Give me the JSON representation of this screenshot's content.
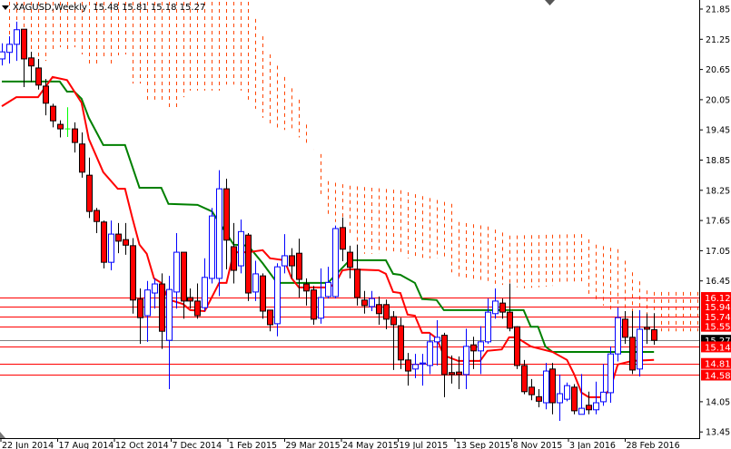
{
  "header": {
    "symbol": "XAGUSD,Weekly",
    "ohlc": "15.48 15.81 15.18 15.27"
  },
  "colors": {
    "bull": "#0000ff",
    "bear": "#ff0000",
    "doji": "#00ff00",
    "tenkan": "#ff0000",
    "kijun": "#008000",
    "cloud": "#ff4500",
    "level": "#ff0000",
    "current": "#808080"
  },
  "chart_data": {
    "type": "candlestick",
    "title": "XAGUSD,Weekly",
    "ylim": [
      13.45,
      22.0
    ],
    "y_ticks": [
      "21.85",
      "21.25",
      "20.65",
      "20.05",
      "19.45",
      "18.85",
      "18.25",
      "17.65",
      "17.05",
      "16.45",
      "14.05",
      "13.45"
    ],
    "x_ticks": [
      "22 Jun 2014",
      "17 Aug 2014",
      "12 Oct 2014",
      "7 Dec 2014",
      "1 Feb 2015",
      "29 Mar 2015",
      "24 May 2015",
      "19 Jul 2015",
      "13 Sep 2015",
      "8 Nov 2015",
      "3 Jan 2016",
      "28 Feb 2016"
    ],
    "candles_ohlc": [
      [
        20.86,
        21.17,
        20.73,
        21.0
      ],
      [
        20.99,
        21.31,
        20.77,
        21.15
      ],
      [
        21.15,
        21.6,
        20.82,
        21.44
      ],
      [
        21.45,
        21.45,
        20.3,
        20.86
      ],
      [
        20.88,
        21.0,
        20.4,
        20.72
      ],
      [
        20.68,
        20.86,
        20.25,
        20.34
      ],
      [
        20.32,
        20.46,
        19.74,
        19.98
      ],
      [
        19.92,
        19.97,
        19.5,
        19.63
      ],
      [
        19.56,
        19.64,
        19.3,
        19.47
      ],
      [
        19.47,
        19.9,
        19.31,
        19.47
      ],
      [
        19.47,
        19.6,
        19.0,
        19.2
      ],
      [
        19.17,
        19.4,
        18.5,
        18.61
      ],
      [
        18.55,
        18.9,
        17.7,
        17.83
      ],
      [
        17.85,
        17.9,
        17.4,
        17.63
      ],
      [
        17.62,
        17.65,
        16.7,
        16.82
      ],
      [
        16.82,
        17.65,
        16.66,
        17.38
      ],
      [
        17.38,
        17.6,
        17.0,
        17.24
      ],
      [
        17.27,
        17.6,
        16.97,
        17.16
      ],
      [
        17.15,
        17.3,
        15.8,
        16.07
      ],
      [
        16.09,
        16.3,
        15.2,
        15.72
      ],
      [
        15.76,
        16.45,
        15.24,
        16.27
      ],
      [
        16.21,
        16.5,
        15.9,
        16.39
      ],
      [
        16.39,
        16.6,
        15.1,
        15.45
      ],
      [
        15.27,
        16.55,
        14.3,
        16.28
      ],
      [
        16.23,
        17.4,
        15.9,
        17.02
      ],
      [
        17.02,
        17.02,
        15.7,
        16.05
      ],
      [
        16.12,
        16.3,
        15.9,
        16.05
      ],
      [
        16.05,
        16.4,
        15.7,
        15.76
      ],
      [
        15.92,
        16.9,
        15.85,
        16.52
      ],
      [
        16.5,
        17.9,
        16.4,
        17.74
      ],
      [
        16.5,
        18.65,
        16.15,
        18.28
      ],
      [
        18.28,
        18.48,
        16.68,
        17.26
      ],
      [
        17.13,
        17.6,
        16.4,
        16.66
      ],
      [
        16.75,
        17.67,
        16.6,
        17.43
      ],
      [
        17.36,
        17.4,
        16.05,
        16.21
      ],
      [
        16.23,
        16.85,
        16.05,
        16.59
      ],
      [
        16.55,
        16.6,
        15.7,
        15.85
      ],
      [
        15.87,
        15.87,
        15.45,
        15.58
      ],
      [
        15.6,
        16.8,
        15.35,
        16.73
      ],
      [
        16.75,
        17.38,
        16.6,
        16.95
      ],
      [
        16.95,
        17.1,
        16.5,
        16.75
      ],
      [
        17.0,
        17.29,
        16.12,
        16.48
      ],
      [
        16.39,
        16.5,
        15.96,
        16.25
      ],
      [
        16.27,
        16.35,
        15.58,
        15.69
      ],
      [
        15.71,
        16.7,
        15.6,
        16.12
      ],
      [
        16.14,
        16.73,
        16.1,
        16.42
      ],
      [
        16.14,
        17.55,
        16.1,
        17.49
      ],
      [
        17.51,
        17.71,
        16.84,
        17.08
      ],
      [
        17.02,
        17.15,
        16.5,
        16.72
      ],
      [
        16.68,
        17.17,
        15.96,
        16.12
      ],
      [
        16.07,
        16.25,
        15.8,
        15.96
      ],
      [
        15.94,
        16.25,
        15.85,
        16.1
      ],
      [
        15.98,
        16.14,
        15.58,
        15.8
      ],
      [
        15.98,
        16.08,
        15.49,
        15.69
      ],
      [
        15.74,
        15.85,
        14.68,
        15.58
      ],
      [
        15.56,
        15.72,
        14.7,
        14.88
      ],
      [
        14.88,
        15.02,
        14.37,
        14.66
      ],
      [
        14.7,
        15.0,
        14.52,
        14.79
      ],
      [
        14.8,
        15.0,
        14.37,
        14.82
      ],
      [
        14.77,
        15.4,
        14.6,
        15.24
      ],
      [
        15.24,
        15.67,
        14.77,
        15.33
      ],
      [
        15.37,
        15.42,
        14.14,
        14.59
      ],
      [
        14.63,
        14.97,
        14.41,
        14.59
      ],
      [
        14.64,
        14.95,
        14.3,
        14.59
      ],
      [
        14.59,
        15.5,
        14.3,
        15.15
      ],
      [
        15.18,
        15.34,
        14.7,
        15.06
      ],
      [
        15.06,
        15.55,
        14.6,
        15.24
      ],
      [
        15.24,
        16.1,
        15.2,
        15.83
      ],
      [
        15.8,
        16.3,
        15.7,
        16.05
      ],
      [
        16.01,
        16.1,
        15.7,
        15.83
      ],
      [
        15.83,
        16.4,
        15.45,
        15.51
      ],
      [
        15.54,
        15.55,
        14.7,
        14.77
      ],
      [
        14.77,
        14.88,
        14.2,
        14.25
      ],
      [
        14.34,
        14.5,
        14.08,
        14.19
      ],
      [
        14.15,
        14.3,
        13.94,
        14.06
      ],
      [
        14.03,
        14.82,
        13.9,
        14.66
      ],
      [
        14.7,
        14.82,
        13.8,
        14.03
      ],
      [
        14.03,
        14.59,
        13.67,
        14.21
      ],
      [
        14.1,
        14.43,
        14.06,
        14.37
      ],
      [
        14.34,
        14.4,
        13.8,
        13.87
      ],
      [
        13.8,
        14.6,
        13.8,
        13.92
      ],
      [
        13.98,
        14.25,
        13.8,
        13.89
      ],
      [
        13.89,
        14.45,
        13.8,
        14.03
      ],
      [
        14.05,
        14.8,
        13.97,
        14.24
      ],
      [
        14.23,
        15.15,
        14.03,
        15.0
      ],
      [
        15.0,
        15.92,
        14.85,
        15.72
      ],
      [
        15.69,
        15.85,
        15.2,
        15.33
      ],
      [
        15.33,
        15.85,
        14.6,
        14.68
      ],
      [
        14.7,
        15.87,
        14.55,
        15.49
      ],
      [
        15.53,
        15.8,
        15.2,
        15.49
      ],
      [
        15.48,
        15.81,
        15.18,
        15.27
      ]
    ],
    "tenkan_points": [
      [
        0,
        19.92
      ],
      [
        2,
        20.1
      ],
      [
        5,
        20.1
      ],
      [
        7,
        20.5
      ],
      [
        9,
        20.44
      ],
      [
        11,
        19.99
      ],
      [
        12,
        19.27
      ],
      [
        14,
        18.61
      ],
      [
        16,
        18.28
      ],
      [
        17,
        18.28
      ],
      [
        18,
        17.71
      ],
      [
        19,
        17.17
      ],
      [
        20,
        16.99
      ],
      [
        21,
        16.5
      ],
      [
        22,
        16.41
      ],
      [
        23,
        16.08
      ],
      [
        25,
        15.99
      ],
      [
        26,
        15.87
      ],
      [
        28,
        15.85
      ],
      [
        30,
        16.41
      ],
      [
        31,
        16.41
      ],
      [
        32,
        17.02
      ],
      [
        34,
        17.02
      ],
      [
        36,
        17.06
      ],
      [
        37,
        16.9
      ],
      [
        39,
        16.86
      ],
      [
        40,
        16.5
      ],
      [
        41,
        16.32
      ],
      [
        45,
        16.32
      ],
      [
        46,
        16.39
      ],
      [
        47,
        16.66
      ],
      [
        48,
        16.68
      ],
      [
        52,
        16.66
      ],
      [
        53,
        16.59
      ],
      [
        54,
        16.23
      ],
      [
        55,
        16.21
      ],
      [
        56,
        15.78
      ],
      [
        57,
        15.76
      ],
      [
        58,
        15.42
      ],
      [
        59,
        15.42
      ],
      [
        60,
        15.31
      ],
      [
        61,
        14.97
      ],
      [
        63,
        14.86
      ],
      [
        66,
        14.86
      ],
      [
        67,
        15.06
      ],
      [
        69,
        15.09
      ],
      [
        70,
        15.33
      ],
      [
        71,
        15.33
      ],
      [
        73,
        15.15
      ],
      [
        76,
        15.04
      ],
      [
        78,
        14.88
      ],
      [
        79,
        14.59
      ],
      [
        80,
        14.23
      ],
      [
        81,
        14.14
      ],
      [
        83,
        14.14
      ],
      [
        84,
        14.32
      ],
      [
        85,
        14.79
      ],
      [
        87,
        14.86
      ],
      [
        90,
        14.88
      ]
    ],
    "kijun_points": [
      [
        0,
        20.41
      ],
      [
        8,
        20.41
      ],
      [
        9,
        20.21
      ],
      [
        10,
        20.21
      ],
      [
        11,
        20.07
      ],
      [
        12,
        19.69
      ],
      [
        14,
        19.15
      ],
      [
        17,
        19.15
      ],
      [
        19,
        18.3
      ],
      [
        22,
        18.3
      ],
      [
        23,
        17.98
      ],
      [
        27,
        17.96
      ],
      [
        29,
        17.83
      ],
      [
        32,
        17.17
      ],
      [
        34,
        17.15
      ],
      [
        36,
        16.8
      ],
      [
        38,
        16.41
      ],
      [
        45,
        16.41
      ],
      [
        48,
        16.86
      ],
      [
        53,
        16.86
      ],
      [
        54,
        16.59
      ],
      [
        55,
        16.57
      ],
      [
        57,
        16.41
      ],
      [
        58,
        16.09
      ],
      [
        60,
        16.07
      ],
      [
        61,
        15.87
      ],
      [
        72,
        15.87
      ],
      [
        73,
        15.54
      ],
      [
        74,
        15.54
      ],
      [
        75,
        15.15
      ],
      [
        76,
        15.04
      ],
      [
        90,
        15.04
      ]
    ],
    "cloud_upper": [
      [
        0,
        22.0
      ],
      [
        34,
        22.0
      ],
      [
        36,
        21.31
      ],
      [
        37,
        20.95
      ],
      [
        41,
        20.05
      ],
      [
        43,
        19.06
      ],
      [
        44,
        18.97
      ],
      [
        45,
        18.43
      ],
      [
        48,
        18.34
      ],
      [
        55,
        18.25
      ],
      [
        62,
        17.98
      ],
      [
        63,
        17.62
      ],
      [
        67,
        17.53
      ],
      [
        70,
        17.35
      ],
      [
        80,
        17.38
      ],
      [
        82,
        17.17
      ],
      [
        85,
        17.08
      ],
      [
        87,
        16.62
      ],
      [
        89,
        16.26
      ],
      [
        90,
        16.23
      ],
      [
        96,
        16.23
      ]
    ],
    "cloud_lower": [
      [
        1,
        21.17
      ],
      [
        2,
        21.31
      ],
      [
        3,
        21.13
      ],
      [
        4,
        20.9
      ],
      [
        5,
        20.86
      ],
      [
        6,
        20.82
      ],
      [
        7,
        21.04
      ],
      [
        8,
        21.09
      ],
      [
        9,
        21.04
      ],
      [
        10,
        21.09
      ],
      [
        11,
        20.95
      ],
      [
        12,
        20.73
      ],
      [
        13,
        20.73
      ],
      [
        14,
        20.9
      ],
      [
        15,
        20.75
      ],
      [
        16,
        20.93
      ],
      [
        17,
        20.95
      ],
      [
        18,
        20.37
      ],
      [
        19,
        20.37
      ],
      [
        20,
        20.05
      ],
      [
        21,
        20.05
      ],
      [
        22,
        20.01
      ],
      [
        23,
        19.9
      ],
      [
        24,
        19.9
      ],
      [
        25,
        20.1
      ],
      [
        26,
        20.23
      ],
      [
        30,
        20.23
      ],
      [
        31,
        20.35
      ],
      [
        32,
        20.35
      ],
      [
        33,
        20.23
      ],
      [
        35,
        19.87
      ],
      [
        37,
        19.51
      ],
      [
        40,
        19.42
      ],
      [
        43,
        19.06
      ],
      [
        44,
        18.16
      ],
      [
        45,
        17.74
      ],
      [
        46,
        17.62
      ],
      [
        47,
        17.38
      ],
      [
        48,
        17.38
      ],
      [
        49,
        16.99
      ],
      [
        55,
        16.99
      ],
      [
        56,
        16.9
      ],
      [
        61,
        16.9
      ],
      [
        62,
        16.62
      ],
      [
        63,
        16.53
      ],
      [
        66,
        16.44
      ],
      [
        72,
        16.3
      ],
      [
        79,
        16.39
      ],
      [
        80,
        16.39
      ],
      [
        81,
        16.17
      ],
      [
        82,
        16.03
      ],
      [
        83,
        15.96
      ],
      [
        84,
        15.85
      ],
      [
        85,
        15.63
      ],
      [
        86,
        15.63
      ],
      [
        87,
        15.54
      ],
      [
        88,
        15.51
      ],
      [
        89,
        15.45
      ],
      [
        96,
        15.45
      ]
    ],
    "levels": [
      "16.12",
      "15.94",
      "15.74",
      "15.55",
      "15.14",
      "14.81",
      "14.58"
    ],
    "current_price": "15.27"
  }
}
